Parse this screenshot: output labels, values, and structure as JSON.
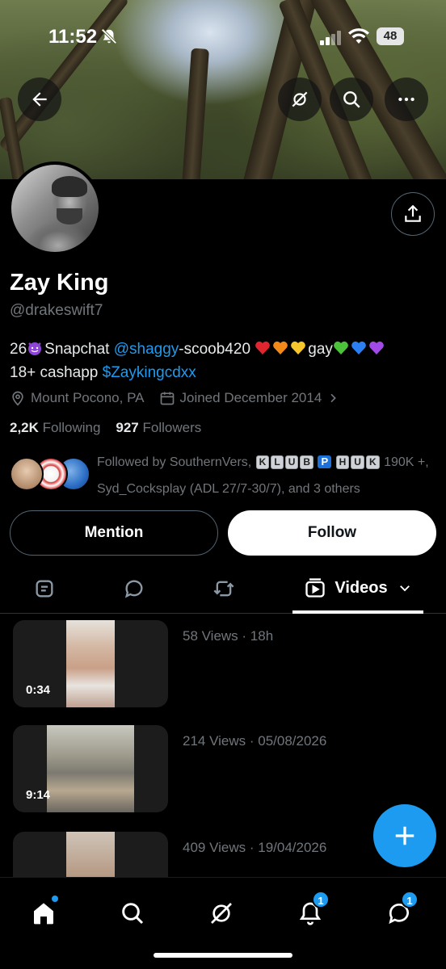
{
  "status_bar": {
    "time": "11:52",
    "battery": "48"
  },
  "profile": {
    "name": "Zay King",
    "handle": "@drakeswift7",
    "bio": {
      "prefix": "26",
      "snapchat_label": "Snapchat",
      "snapchat_link": "@shaggy",
      "snapchat_rest": "-scoob420",
      "gay": "gay",
      "line2_prefix": "18+ cashapp",
      "cashapp_link": "$Zaykingcdxx"
    },
    "location": "Mount Pocono, PA",
    "joined": "Joined December 2014",
    "following_count": "2,2K",
    "following_label": "Following",
    "followers_count": "927",
    "followers_label": "Followers",
    "followed_by": {
      "line1_prefix": "Followed by SouthernVers,",
      "klub": [
        "K",
        "L",
        "U",
        "B"
      ],
      "p": "P",
      "huk": [
        "H",
        "U",
        "K"
      ],
      "line1_suffix": "190K +,",
      "line2": "Syd_Cocksplay (ADL 27/7-30/7), and 3 others"
    }
  },
  "buttons": {
    "mention": "Mention",
    "follow": "Follow"
  },
  "tabs": {
    "videos_label": "Videos"
  },
  "videos": [
    {
      "duration": "0:34",
      "meta": "58 Views · 18h"
    },
    {
      "duration": "9:14",
      "meta": "214 Views · 05/08/2026"
    },
    {
      "duration": "",
      "meta": "409 Views · 19/04/2026"
    }
  ],
  "nav": {
    "notifications_badge": "1",
    "messages_badge": "1"
  },
  "colors": {
    "accent": "#1d9bf0",
    "background": "#000000",
    "muted": "#71767b"
  }
}
